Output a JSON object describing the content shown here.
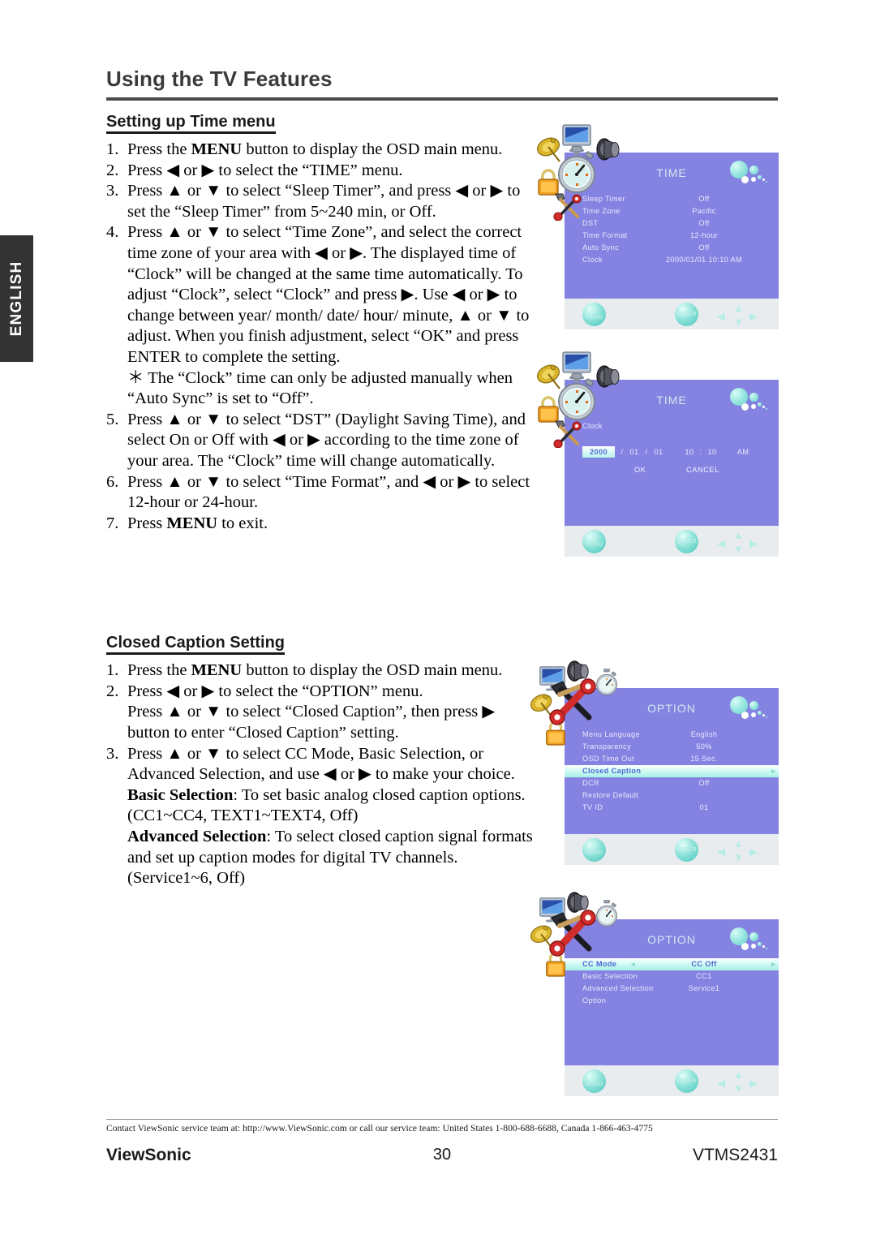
{
  "sidebar": {
    "language_tab": "ENGLISH"
  },
  "header": {
    "title": "Using the TV Features"
  },
  "sections": [
    {
      "heading": "Setting up Time menu",
      "steps": [
        {
          "num": "1.",
          "text": "Press the MENU button to display the OSD main menu."
        },
        {
          "num": "2.",
          "text": "Press ◀ or ▶ to select the “TIME” menu."
        },
        {
          "num": "3.",
          "text": "Press ▲ or ▼ to select “Sleep Timer”, and press ◀ or ▶ to set the “Sleep Timer” from 5~240 min, or Off."
        },
        {
          "num": "4.",
          "text": "Press ▲ or ▼ to select “Time Zone”, and select the correct time zone of your area with ◀ or ▶. The displayed time of “Clock” will be changed at the same time automatically. To adjust “Clock”, select “Clock” and press ▶. Use ◀ or ▶ to change between year/ month/ date/ hour/ minute, ▲ or ▼ to adjust. When you finish adjustment, select “OK” and press ENTER to complete the setting."
        },
        {
          "num": "＊",
          "text": "The “Clock” time can only be adjusted manually when “Auto Sync” is set to “Off”."
        },
        {
          "num": "5.",
          "text": "Press ▲ or ▼ to select “DST” (Daylight Saving Time), and select On or Off with ◀ or ▶ according to the time zone of your area. The “Clock” time will change automatically."
        },
        {
          "num": "6.",
          "text": "Press ▲ or ▼ to select “Time Format”, and ◀ or ▶ to select 12-hour or 24-hour."
        },
        {
          "num": "7.",
          "text": "Press MENU to exit."
        }
      ]
    },
    {
      "heading": "Closed Caption Setting",
      "steps": [
        {
          "num": "1.",
          "text": "Press the MENU button to display the OSD main menu."
        },
        {
          "num": "2.",
          "text": "Press ◀ or ▶ to select the “OPTION” menu."
        },
        {
          "num": "",
          "text": "Press ▲ or ▼ to select “Closed Caption”, then press ▶ button to enter “Closed Caption” setting."
        },
        {
          "num": "3.",
          "text": "Press ▲ or ▼ to select CC Mode, Basic Selection, or Advanced Selection, and use ◀ or ▶ to make your choice."
        },
        {
          "num": "",
          "text": "Basic Selection: To set basic analog closed caption options. (CC1~CC4, TEXT1~TEXT4, Off)"
        },
        {
          "num": "",
          "text": "Advanced Selection: To select closed caption signal formats and set up caption modes for digital TV channels. (Service1~6, Off)"
        }
      ]
    }
  ],
  "osd": {
    "nav": {
      "menu_line1": "TV",
      "menu_line2": "MENU",
      "enter": "ENTER"
    },
    "time_main": {
      "title": "TIME",
      "rows": [
        {
          "key": "Sleep Timer",
          "value": "Off"
        },
        {
          "key": "Time Zone",
          "value": "Pacific"
        },
        {
          "key": "DST",
          "value": "Off"
        },
        {
          "key": "Time Format",
          "value": "12-hour"
        },
        {
          "key": "Auto Sync",
          "value": "Off"
        },
        {
          "key": "Clock",
          "value": "2000/01/01 10:10 AM"
        }
      ]
    },
    "time_clock": {
      "title": "TIME",
      "label": "Clock",
      "year": "2000",
      "sep1": "/",
      "month": "01",
      "sep2": "/",
      "date": "01",
      "hour": "10",
      "colon": ":",
      "minute": "10",
      "meridiem": "AM",
      "ok": "OK",
      "cancel": "CANCEL"
    },
    "option_main": {
      "title": "OPTION",
      "rows": [
        {
          "key": "Menu Language",
          "value": "English",
          "highlight": false
        },
        {
          "key": "Transparency",
          "value": "50%",
          "highlight": false
        },
        {
          "key": "OSD Time Out",
          "value": "15 Sec.",
          "highlight": false
        },
        {
          "key": "Closed Caption",
          "value": "",
          "highlight": true
        },
        {
          "key": "DCR",
          "value": "Off",
          "highlight": false
        },
        {
          "key": "Restore Default",
          "value": "",
          "highlight": false
        },
        {
          "key": "TV ID",
          "value": "01",
          "highlight": false
        }
      ]
    },
    "option_cc": {
      "title": "OPTION",
      "rows": [
        {
          "key": "CC Mode",
          "value": "CC Off",
          "highlight": true
        },
        {
          "key": "Basic Selection",
          "value": "CC1",
          "highlight": false
        },
        {
          "key": "Advanced Selection",
          "value": "Service1",
          "highlight": false
        },
        {
          "key": "Option",
          "value": "",
          "highlight": false
        }
      ]
    }
  },
  "footer": {
    "contact": "Contact ViewSonic service team at: http://www.ViewSonic.com or call our service team: United States 1-800-688-6688, Canada 1-866-463-4775",
    "brand": "ViewSonic",
    "page_number": "30",
    "model": "VTMS2431"
  },
  "colors": {
    "panel_purple": "#8583e2",
    "panel_chrome": "#e9ecee",
    "highlight_mint": "#a9f0e6",
    "title_text": "#cfe9ef",
    "tab_dark": "#333333"
  }
}
